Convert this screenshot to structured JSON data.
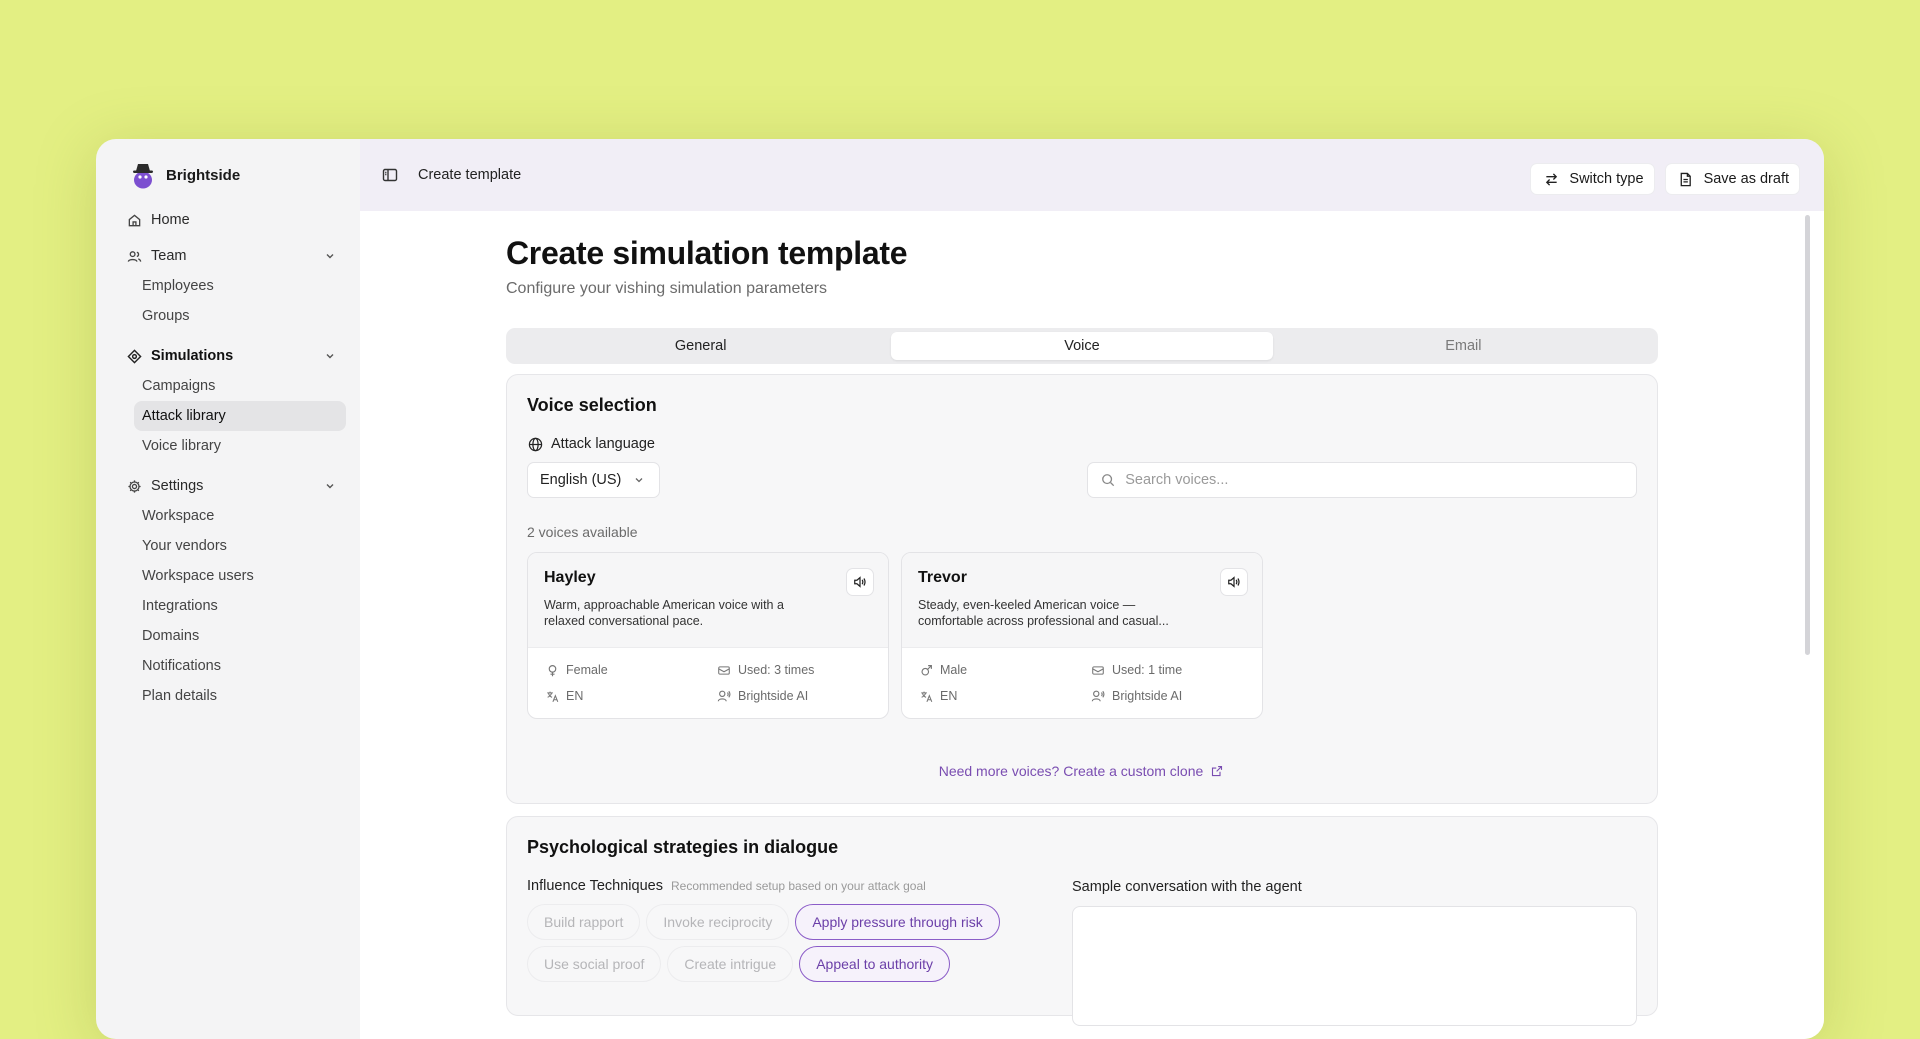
{
  "app": {
    "brand": "Brightside"
  },
  "sidebar": {
    "home": "Home",
    "team": {
      "label": "Team",
      "items": [
        "Employees",
        "Groups"
      ]
    },
    "simulations": {
      "label": "Simulations",
      "items": [
        "Campaigns",
        "Attack library",
        "Voice library"
      ],
      "active": "Attack library"
    },
    "settings": {
      "label": "Settings",
      "items": [
        "Workspace",
        "Your vendors",
        "Workspace users",
        "Integrations",
        "Domains",
        "Notifications",
        "Plan details"
      ]
    }
  },
  "topbar": {
    "breadcrumb": "Create template",
    "switch_type": "Switch type",
    "save_draft": "Save as draft"
  },
  "page": {
    "title": "Create simulation template",
    "subtitle": "Configure your vishing simulation parameters"
  },
  "tabs": [
    {
      "label": "General",
      "state": "normal"
    },
    {
      "label": "Voice",
      "state": "active"
    },
    {
      "label": "Email",
      "state": "dim"
    }
  ],
  "voice_selection": {
    "title": "Voice selection",
    "language_label": "Attack language",
    "language_value": "English (US)",
    "search_placeholder": "Search voices...",
    "count": "2 voices available",
    "voices": [
      {
        "name": "Hayley",
        "desc": "Warm, approachable American voice with a relaxed conversational pace.",
        "gender": "Female",
        "used": "Used: 3 times",
        "lang": "EN",
        "source": "Brightside AI"
      },
      {
        "name": "Trevor",
        "desc": "Steady, even-keeled American voice — comfortable across professional and casual...",
        "gender": "Male",
        "used": "Used: 1 time",
        "lang": "EN",
        "source": "Brightside AI"
      }
    ],
    "more_link": "Need more voices? Create a custom clone"
  },
  "strategies": {
    "title": "Psychological strategies in dialogue",
    "techniques_label": "Influence Techniques",
    "techniques_hint": "Recommended setup based on your attack goal",
    "chips": [
      {
        "label": "Build rapport",
        "on": false
      },
      {
        "label": "Invoke reciprocity",
        "on": false
      },
      {
        "label": "Apply pressure through risk",
        "on": true
      },
      {
        "label": "Use social proof",
        "on": false
      },
      {
        "label": "Create intrigue",
        "on": false
      },
      {
        "label": "Appeal to authority",
        "on": true
      }
    ],
    "sample_label": "Sample conversation with the agent"
  },
  "colors": {
    "background": "#e3ef83",
    "accent": "#7a4db1"
  }
}
